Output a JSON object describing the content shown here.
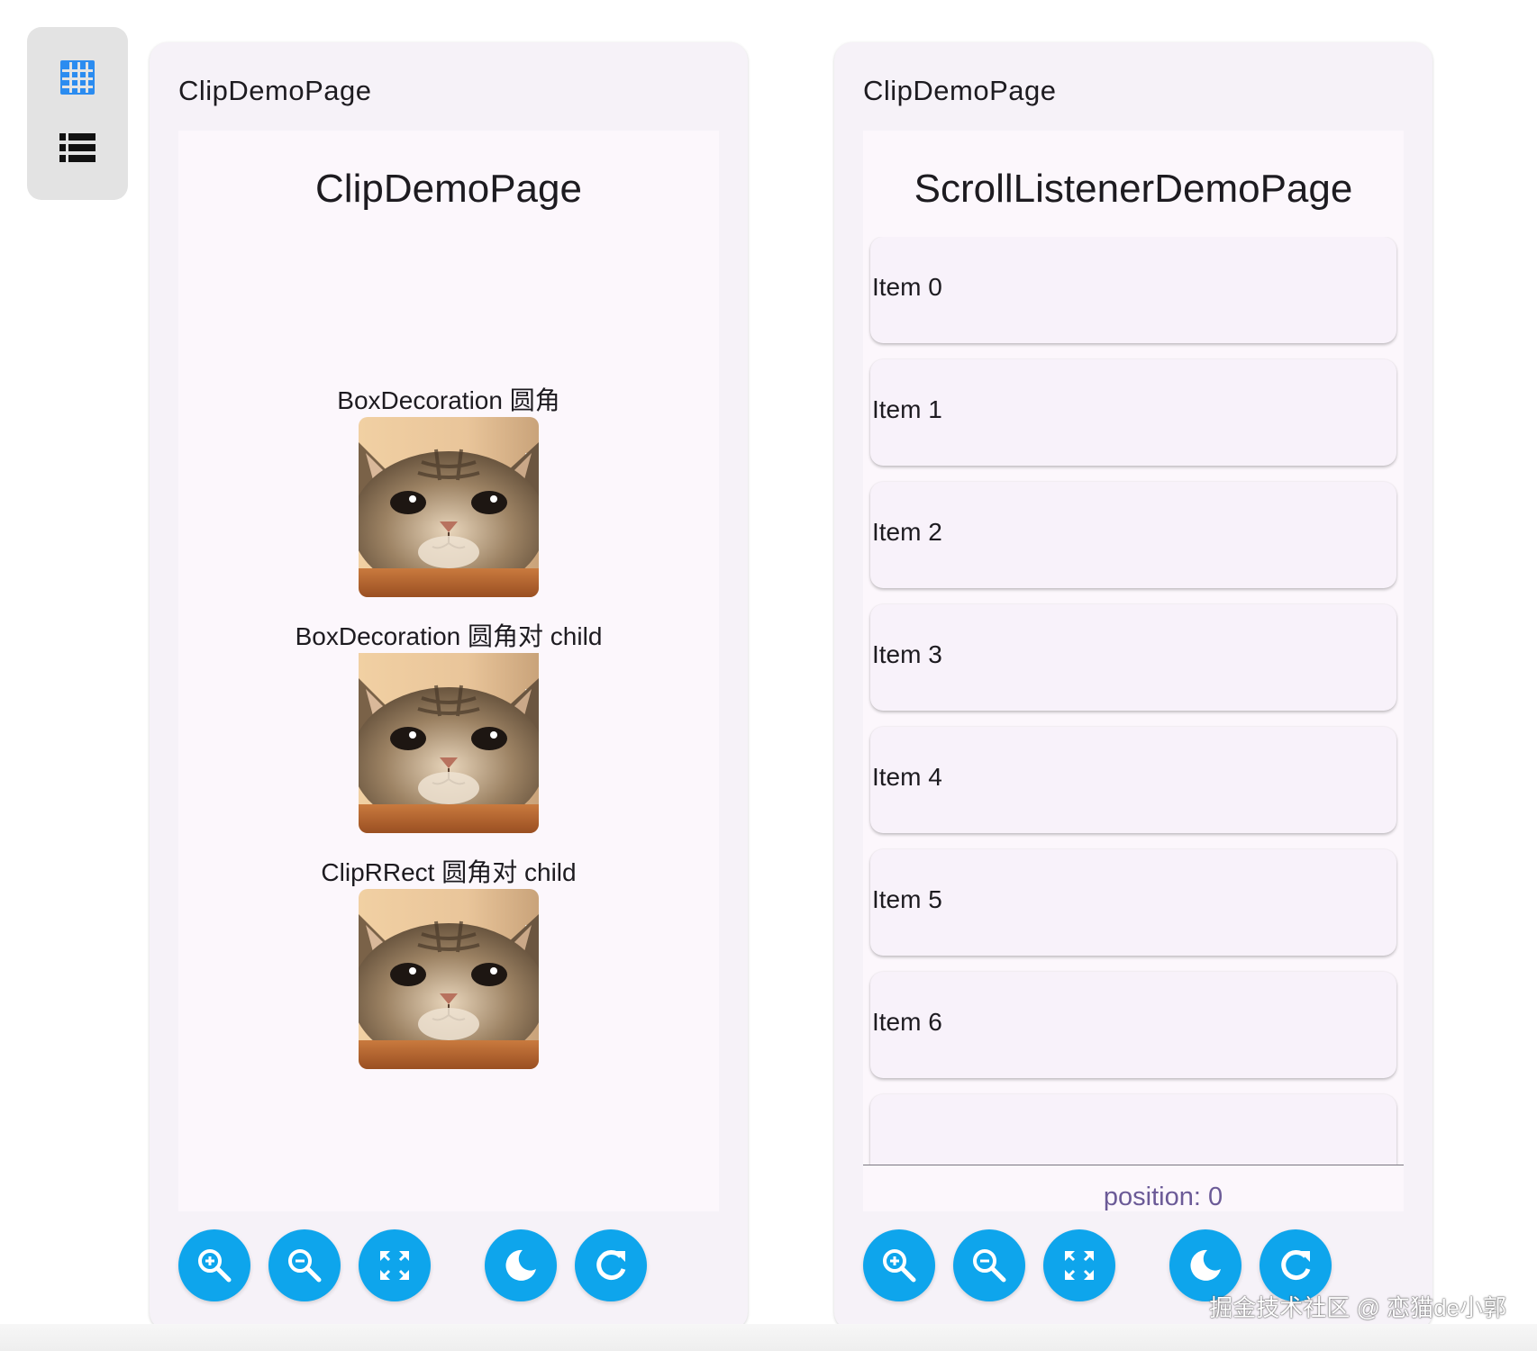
{
  "colors": {
    "accent": "#0ea5ec",
    "position_text": "#6b5a97",
    "grid_icon": "#2b8cf0"
  },
  "rail": {
    "items": [
      {
        "icon": "grid-view-icon"
      },
      {
        "icon": "list-view-icon"
      }
    ]
  },
  "left_panel": {
    "title": "ClipDemoPage",
    "app_title": "ClipDemoPage",
    "demos": [
      {
        "label": "BoxDecoration 圆角"
      },
      {
        "label": "BoxDecoration 圆角对 child"
      },
      {
        "label": "ClipRRect 圆角对 child"
      }
    ]
  },
  "right_panel": {
    "title": "ClipDemoPage",
    "app_title": "ScrollListenerDemoPage",
    "items": [
      "Item 0",
      "Item 1",
      "Item 2",
      "Item 3",
      "Item 4",
      "Item 5",
      "Item 6"
    ],
    "position_text": "position: 0"
  },
  "fabs": [
    {
      "icon": "zoom-in-icon"
    },
    {
      "icon": "zoom-out-icon"
    },
    {
      "icon": "fullscreen-icon"
    },
    {
      "icon": "dark-mode-icon"
    },
    {
      "icon": "refresh-icon"
    }
  ],
  "watermark": "掘金技术社区 @ 恋猫de小郭"
}
